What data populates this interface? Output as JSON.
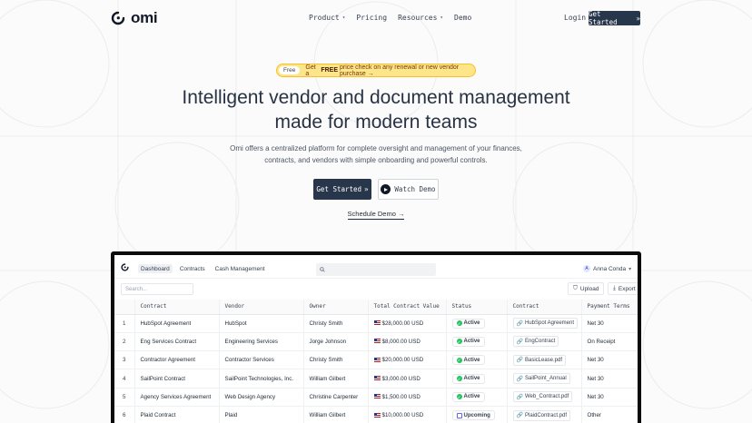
{
  "nav": {
    "logo_text": "omi",
    "links": [
      {
        "label": "Product",
        "has_dropdown": true
      },
      {
        "label": "Pricing",
        "has_dropdown": false
      },
      {
        "label": "Resources",
        "has_dropdown": true
      },
      {
        "label": "Demo",
        "has_dropdown": false
      }
    ],
    "login_label": "Login",
    "cta_label": "Get Started",
    "cta_arrow": "»"
  },
  "promo": {
    "pill": "Free",
    "text_before": "Get a",
    "highlight": "FREE",
    "text_after": "price check on any renewal or new vendor purchase →"
  },
  "hero": {
    "title_line1": "Intelligent vendor and document management",
    "title_line2": "made for modern teams",
    "subtitle_line1": "Omi offers a centralized platform for complete oversight and management of your finances,",
    "subtitle_line2": "contracts, and vendors with simple onboarding and powerful controls.",
    "primary_label": "Get Started",
    "primary_arrow": "»",
    "demo_label": "Watch Demo",
    "schedule_label": "Schedule Demo →"
  },
  "app": {
    "tabs": [
      {
        "label": "Dashboard",
        "active": true
      },
      {
        "label": "Contracts",
        "active": false
      },
      {
        "label": "Cash Management",
        "active": false
      }
    ],
    "user": {
      "initial": "A",
      "name": "Anna Conda"
    },
    "search_placeholder": "Search...",
    "upload_label": "Upload",
    "export_label": "Export",
    "columns": [
      "",
      "Contract",
      "Vendor",
      "Owner",
      "Total Contract Value",
      "Status",
      "Contract",
      "Payment Terms"
    ],
    "rows": [
      {
        "n": "1",
        "contract": "HubSpot Agreement",
        "vendor": "HubSpot",
        "owner": "Christy Smith",
        "value": "$28,000.00 USD",
        "status": "Active",
        "file": "HubSpot Agreement",
        "terms": "Net 30"
      },
      {
        "n": "2",
        "contract": "Eng Services Contract",
        "vendor": "Engineering Services",
        "owner": "Jorge Johnson",
        "value": "$8,000.00 USD",
        "status": "Active",
        "file": "EngContract",
        "terms": "On Receipt"
      },
      {
        "n": "3",
        "contract": "Contractor Agreement",
        "vendor": "Contractor Services",
        "owner": "Christy Smith",
        "value": "$20,000.00 USD",
        "status": "Active",
        "file": "BasicLease.pdf",
        "terms": "Net 30"
      },
      {
        "n": "4",
        "contract": "SailPoint Contract",
        "vendor": "SailPoint Technologies, Inc.",
        "owner": "William Gilbert",
        "value": "$3,000.00 USD",
        "status": "Active",
        "file": "SailPoint_Annual",
        "terms": "Net 30"
      },
      {
        "n": "5",
        "contract": "Agency Services Agreement",
        "vendor": "Web Design Agency",
        "owner": "Christine Carpenter",
        "value": "$1,500.00 USD",
        "status": "Active",
        "file": "Web_Contract.pdf",
        "terms": "Net 30"
      },
      {
        "n": "6",
        "contract": "Plaid Contract",
        "vendor": "Plaid",
        "owner": "William Gilbert",
        "value": "$10,000.00 USD",
        "status": "Upcoming",
        "file": "PlaidContract.pdf",
        "terms": "Other"
      }
    ]
  },
  "colors": {
    "primary": "#27364a",
    "promo_bg": "#fde68a",
    "active_green": "#22c55e"
  }
}
